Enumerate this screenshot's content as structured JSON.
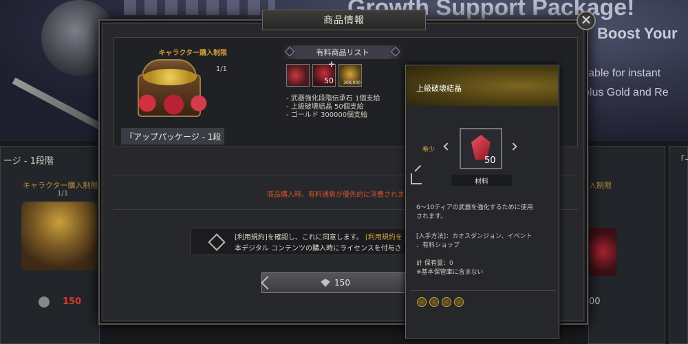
{
  "background": {
    "banner_headline": "Growth Support Package!",
    "banner_sub1": "Boost Your",
    "banner_sub2": "ilable for instant",
    "banner_sub3": "plus Gold and Re",
    "left_card": {
      "title": "ージ - 1段階",
      "limit_label": "キャラクター購入制限",
      "limit_count": "1/1",
      "price": "150"
    },
    "right_card": {
      "limit_label": "入制限",
      "price": "00"
    },
    "far_card_title": "「ー"
  },
  "modal": {
    "title": "商品情報",
    "close_label": "✕",
    "limit_label": "キャラクター購入制限",
    "limit_count": "1/1",
    "package_name": "『アップパッケージ - 1段",
    "paid_list_title": "有料商品リスト",
    "slots": [
      {
        "qty": ""
      },
      {
        "qty": "50"
      },
      {
        "qty": "300,000"
      }
    ],
    "contents": [
      "- 武器強化段階伝承石 1個支給",
      "- 上級破壊結晶 50個支給",
      "- ゴールド 300000個支給"
    ],
    "notice": "商品購入時、有料通貨が優先的に消費されま",
    "terms_line1_a": "[利用規約]を確認し、これに同意します。",
    "terms_line1_b": "[利用規約を",
    "terms_line2": "本デジタル コンテンツの購入時にライセンスを付与さ",
    "price": "150"
  },
  "tooltip": {
    "title": "上級破壊結晶",
    "rarity": "希少",
    "qty": "50",
    "category": "材料",
    "desc1": "6〜10ティアの武器を強化するために使用",
    "desc2": "されます。",
    "source1": "[入手方法]：カオスダンジョン、イベント",
    "source2": "、有料ショップ",
    "stock": "計 保有量：0",
    "stock_note": "※基本保管庫に含まない"
  },
  "colors": {
    "accent_gold": "#d19b3d",
    "notice_red": "#d5502c",
    "price_red": "#d63a2e"
  }
}
